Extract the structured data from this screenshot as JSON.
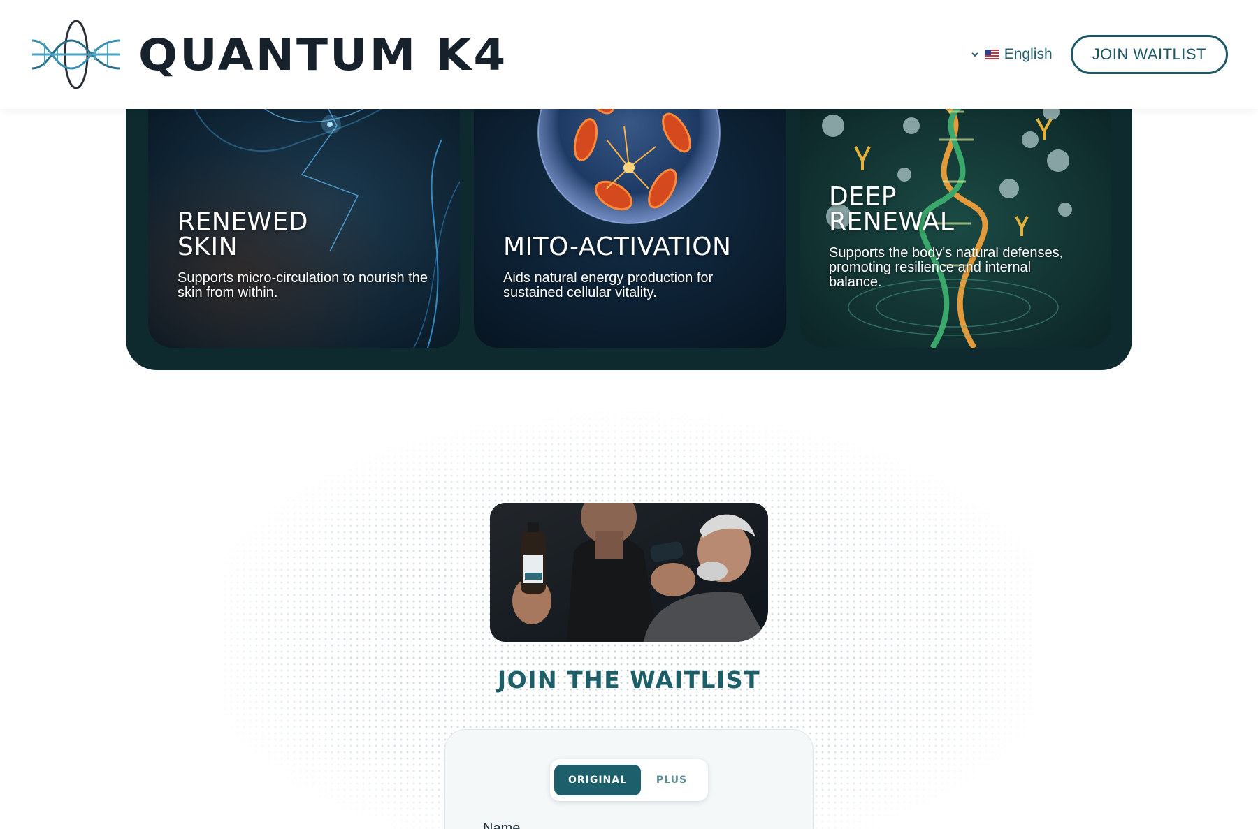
{
  "header": {
    "brand_name": "QUANTUM K4",
    "logo_icon": "dna-atom-logo-icon",
    "language": {
      "label": "English",
      "flag": "us-flag-icon",
      "chevron": "chevron-down-icon"
    },
    "cta_label": "JOIN WAITLIST"
  },
  "features": {
    "cards": [
      {
        "title": "RENEWED\nSKIN",
        "description": "Supports micro-circulation to nourish the skin from within.",
        "image": "skin-energy-lines-image"
      },
      {
        "title": "MITO-ACTIVATION",
        "description": "Aids natural energy production for sustained cellular vitality.",
        "image": "mitochondria-sphere-image"
      },
      {
        "title": "DEEP\nRENEWAL",
        "description": "Supports the body's natural defenses, promoting resilience and internal balance.",
        "image": "dna-helix-image"
      }
    ]
  },
  "waitlist": {
    "hero_image": "product-bottle-men-image",
    "title": "JOIN THE WAITLIST",
    "toggle": {
      "options": [
        "ORIGINAL",
        "PLUS"
      ],
      "selected": "ORIGINAL"
    },
    "name_label": "Name"
  },
  "colors": {
    "dark_teal_panel": "#0e2a2f",
    "accent_teal": "#1d5f6b",
    "brand_text": "#17212c",
    "button_border": "#1e5866"
  }
}
